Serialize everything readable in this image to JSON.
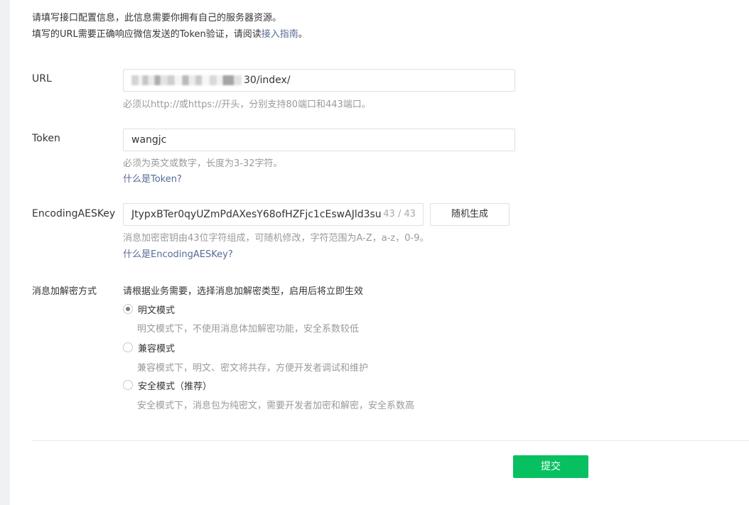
{
  "intro": {
    "line1": "请填写接口配置信息，此信息需要你拥有自己的服务器资源。",
    "line2_prefix": "填写的URL需要正确响应微信发送的Token验证，请阅读",
    "line2_link": "接入指南",
    "line2_suffix": "。"
  },
  "url": {
    "label": "URL",
    "value_visible": "30/index/",
    "hint": "必须以http://或https://开头，分别支持80端口和443端口。"
  },
  "token": {
    "label": "Token",
    "value": "wangjc",
    "hint": "必须为英文或数字，长度为3-32字符。",
    "help_link": "什么是Token?"
  },
  "aes": {
    "label": "EncodingAESKey",
    "value": "JtypxBTer0qyUZmPdAXesY68ofHZFjc1cEswAJld3su",
    "counter": "43 / 43",
    "generate_button": "随机生成",
    "hint": "消息加密密钥由43位字符组成，可随机修改，字符范围为A-Z，a-z，0-9。",
    "help_link": "什么是EncodingAESKey?"
  },
  "encryption": {
    "label": "消息加解密方式",
    "instruction": "请根据业务需要，选择消息加解密类型，启用后将立即生效",
    "options": [
      {
        "label": "明文模式",
        "desc": "明文模式下，不使用消息体加解密功能，安全系数较低",
        "checked": true
      },
      {
        "label": "兼容模式",
        "desc": "兼容模式下，明文、密文将共存，方便开发者调试和维护",
        "checked": false
      },
      {
        "label": "安全模式（推荐）",
        "desc": "安全模式下，消息包为纯密文，需要开发者加密和解密，安全系数高",
        "checked": false
      }
    ]
  },
  "submit": {
    "label": "提交",
    "color": "#07c160"
  },
  "colors": {
    "link": "#576b95",
    "hint": "#9a9a9a",
    "text": "#353535"
  }
}
